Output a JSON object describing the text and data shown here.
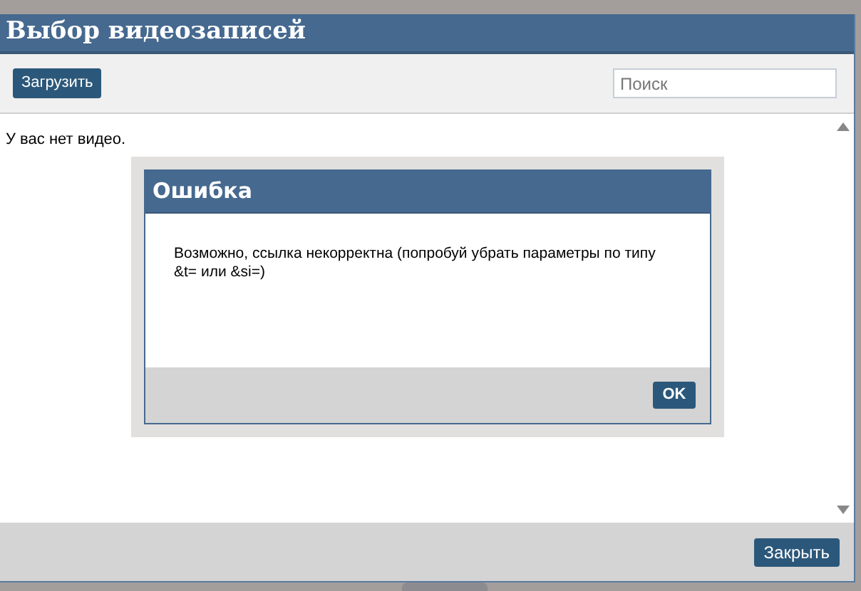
{
  "window": {
    "title": "Выбор видеозаписей"
  },
  "toolbar": {
    "upload_button": "Загрузить",
    "search": {
      "placeholder": "Поиск"
    }
  },
  "content": {
    "empty_message": "У вас нет видео."
  },
  "error_dialog": {
    "title": "Ошибка",
    "message": "Возможно, ссылка некорректна (попробуй убрать параметры по типу &t= или &si=)",
    "ok_button": "OK"
  },
  "footer": {
    "close_button": "Закрыть"
  }
}
